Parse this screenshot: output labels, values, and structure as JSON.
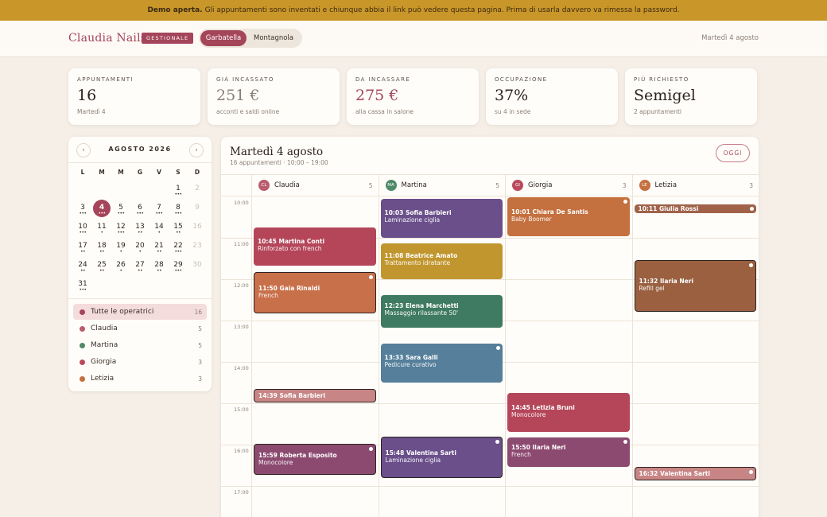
{
  "banner": {
    "bold": "Demo aperta.",
    "text": "Gli appuntamenti sono inventati e chiunque abbia il link può vedere questa pagina. Prima di usarla davvero va rimessa la password."
  },
  "header": {
    "brand": "Claudia Nails",
    "badge": "GESTIONALE",
    "locations": [
      "Garbatella",
      "Montagnola"
    ],
    "active_location": "Garbatella",
    "date": "Martedì 4 agosto"
  },
  "kpis": [
    {
      "label": "APPUNTAMENTI",
      "value": "16",
      "sub": "Martedì 4",
      "color": "#2d2320"
    },
    {
      "label": "GIÀ INCASSATO",
      "value": "251 €",
      "sub": "acconti e saldi online",
      "color": "#8a7f78"
    },
    {
      "label": "DA INCASSARE",
      "value": "275 €",
      "sub": "alla cassa in salone",
      "color": "#a4455a"
    },
    {
      "label": "OCCUPAZIONE",
      "value": "37%",
      "sub": "su 4 in sede",
      "color": "#2d2320"
    },
    {
      "label": "PIÙ RICHIESTO",
      "value": "Semigel",
      "sub": "2 appuntamenti",
      "color": "#2d2320"
    }
  ],
  "calendar": {
    "title": "AGOSTO 2026",
    "prev": "‹",
    "next": "›",
    "weekdays": [
      "L",
      "M",
      "M",
      "G",
      "V",
      "S",
      "D"
    ],
    "days": [
      {
        "n": "1",
        "dots": "•••"
      },
      {
        "n": "2",
        "dots": ""
      },
      {
        "n": "3",
        "dots": "•••"
      },
      {
        "n": "4",
        "dots": "•••"
      },
      {
        "n": "5",
        "dots": "•••"
      },
      {
        "n": "6",
        "dots": "•••"
      },
      {
        "n": "7",
        "dots": "•••"
      },
      {
        "n": "8",
        "dots": "•••"
      },
      {
        "n": "9",
        "dots": ""
      },
      {
        "n": "10",
        "dots": "•••"
      },
      {
        "n": "11",
        "dots": "•"
      },
      {
        "n": "12",
        "dots": "•••"
      },
      {
        "n": "13",
        "dots": "••"
      },
      {
        "n": "14",
        "dots": "•"
      },
      {
        "n": "15",
        "dots": "••"
      },
      {
        "n": "16",
        "dots": ""
      },
      {
        "n": "17",
        "dots": "••"
      },
      {
        "n": "18",
        "dots": "••"
      },
      {
        "n": "19",
        "dots": "•"
      },
      {
        "n": "20",
        "dots": "•"
      },
      {
        "n": "21",
        "dots": "••"
      },
      {
        "n": "22",
        "dots": "•••"
      },
      {
        "n": "23",
        "dots": ""
      },
      {
        "n": "24",
        "dots": "••"
      },
      {
        "n": "25",
        "dots": "••"
      },
      {
        "n": "26",
        "dots": "•"
      },
      {
        "n": "27",
        "dots": "••"
      },
      {
        "n": "28",
        "dots": "••"
      },
      {
        "n": "29",
        "dots": "•••"
      },
      {
        "n": "30",
        "dots": ""
      },
      {
        "n": "31",
        "dots": "•••"
      }
    ],
    "selected": "4",
    "dim_days": [
      "2",
      "9",
      "16",
      "23",
      "30"
    ]
  },
  "operators": [
    {
      "name": "Tutte le operatrici",
      "count": "16",
      "color": "#a4455a",
      "active": true
    },
    {
      "name": "Claudia",
      "count": "5",
      "color": "#b85c6e",
      "active": false
    },
    {
      "name": "Martina",
      "count": "5",
      "color": "#4f8a68",
      "active": false
    },
    {
      "name": "Giorgia",
      "count": "3",
      "color": "#b84a5c",
      "active": false
    },
    {
      "name": "Letizia",
      "count": "3",
      "color": "#c4703f",
      "active": false
    }
  ],
  "schedule": {
    "title": "Martedì 4 agosto",
    "subtitle": "16 appuntamenti · 10:00 – 19:00",
    "today_button": "OGGI",
    "hours": [
      "10:00",
      "11:00",
      "12:00",
      "13:00",
      "14:00",
      "15:00",
      "16:00",
      "17:00"
    ],
    "columns": [
      {
        "initials": "CL",
        "name": "Claudia",
        "count": "5",
        "color": "#b85c6e"
      },
      {
        "initials": "MA",
        "name": "Martina",
        "count": "5",
        "color": "#4f8a68"
      },
      {
        "initials": "GI",
        "name": "Giorgia",
        "count": "3",
        "color": "#b84a5c"
      },
      {
        "initials": "LE",
        "name": "Letizia",
        "count": "3",
        "color": "#c4703f"
      }
    ],
    "appointments": [
      {
        "col": 0,
        "start": "10:45",
        "minutes": 55,
        "client": "Martina Conti",
        "service": "Rinforzato con french",
        "color": "#b5465a",
        "border": false,
        "pip": false
      },
      {
        "col": 0,
        "start": "11:50",
        "minutes": 60,
        "client": "Gaia Rinaldi",
        "service": "French",
        "color": "#c8704a",
        "border": true,
        "pip": true
      },
      {
        "col": 0,
        "start": "14:39",
        "minutes": 20,
        "client": "Sofia Barbieri",
        "service": "",
        "color": "#c88585",
        "border": true,
        "pip": false
      },
      {
        "col": 0,
        "start": "15:59",
        "minutes": 45,
        "client": "Roberta Esposito",
        "service": "Monocolore",
        "color": "#8c4a70",
        "border": true,
        "pip": true
      },
      {
        "col": 1,
        "start": "10:03",
        "minutes": 57,
        "client": "Sofia Barbieri",
        "service": "Laminazione ciglia",
        "color": "#6a4f8a",
        "border": false,
        "pip": false
      },
      {
        "col": 1,
        "start": "11:08",
        "minutes": 52,
        "client": "Beatrice Amato",
        "service": "Trattamento idratante",
        "color": "#c1962e",
        "border": false,
        "pip": false
      },
      {
        "col": 1,
        "start": "12:23",
        "minutes": 47,
        "client": "Elena Marchetti",
        "service": "Massaggio rilassante 50'",
        "color": "#3f7a62",
        "border": false,
        "pip": false
      },
      {
        "col": 1,
        "start": "13:33",
        "minutes": 57,
        "client": "Sara Galli",
        "service": "Pedicure curativo",
        "color": "#557f9a",
        "border": false,
        "pip": true
      },
      {
        "col": 1,
        "start": "15:48",
        "minutes": 60,
        "client": "Valentina Sarti",
        "service": "Laminazione ciglia",
        "color": "#6a4f8a",
        "border": true,
        "pip": true
      },
      {
        "col": 2,
        "start": "10:01",
        "minutes": 57,
        "client": "Chiara De Santis",
        "service": "Baby Boomer",
        "color": "#c4703f",
        "border": false,
        "pip": true
      },
      {
        "col": 2,
        "start": "14:45",
        "minutes": 57,
        "client": "Letizia Bruni",
        "service": "Monocolore",
        "color": "#b5465a",
        "border": false,
        "pip": false
      },
      {
        "col": 2,
        "start": "15:50",
        "minutes": 42,
        "client": "Ilaria Neri",
        "service": "French",
        "color": "#8c4a70",
        "border": false,
        "pip": true
      },
      {
        "col": 3,
        "start": "10:11",
        "minutes": 12,
        "client": "Giulia Rossi",
        "service": "",
        "color": "#a0634a",
        "border": false,
        "pip": true
      },
      {
        "col": 3,
        "start": "11:32",
        "minutes": 75,
        "client": "Ilaria Neri",
        "service": "Refill gel",
        "color": "#9a6040",
        "border": true,
        "pip": true
      },
      {
        "col": 3,
        "start": "16:32",
        "minutes": 20,
        "client": "Valentina Sarti",
        "service": "",
        "color": "#c88585",
        "border": true,
        "pip": true
      }
    ]
  }
}
